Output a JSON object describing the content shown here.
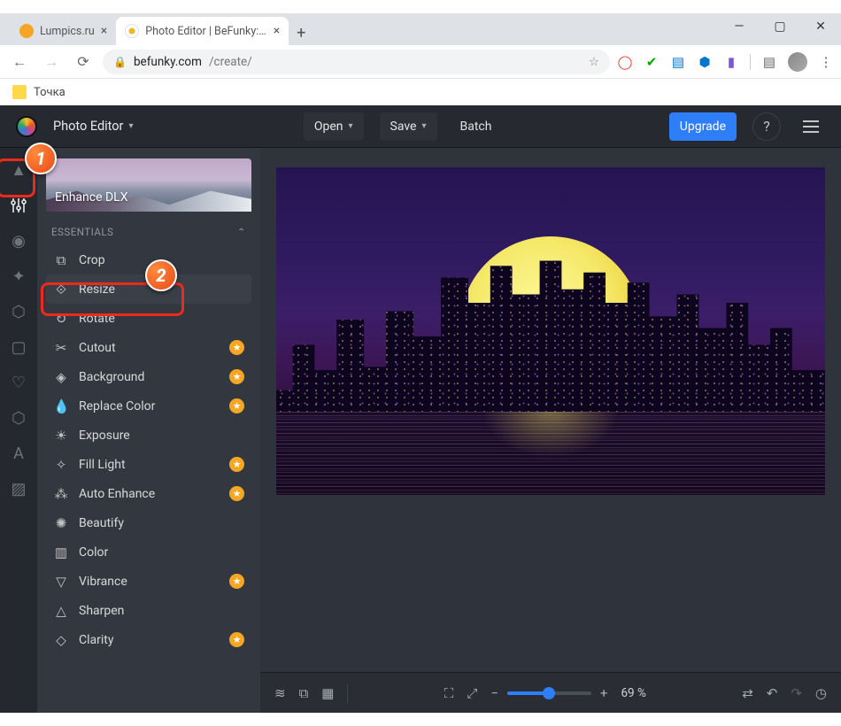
{
  "browser": {
    "tabs": [
      {
        "title": "Lumpics.ru",
        "favcolor": "#f5a623"
      },
      {
        "title": "Photo Editor | BeFunky: Free Onli",
        "favcolor": "#fff"
      }
    ],
    "url_domain": "befunky.com",
    "url_path": "/create/",
    "bookmark": "Точка",
    "ext_icons": [
      "star",
      "red",
      "green",
      "blue",
      "cube",
      "purple",
      "sep",
      "chat"
    ]
  },
  "app": {
    "mode": "Photo Editor",
    "open": "Open",
    "save": "Save",
    "batch": "Batch",
    "upgrade": "Upgrade"
  },
  "panel": {
    "hero": "Enhance DLX",
    "section": "ESSENTIALS",
    "items": [
      {
        "icon": "crop",
        "label": "Crop",
        "premium": false
      },
      {
        "icon": "resize",
        "label": "Resize",
        "premium": false,
        "highlight": true
      },
      {
        "icon": "rotate",
        "label": "Rotate",
        "premium": false
      },
      {
        "icon": "cutout",
        "label": "Cutout",
        "premium": true
      },
      {
        "icon": "bg",
        "label": "Background",
        "premium": true
      },
      {
        "icon": "replace",
        "label": "Replace Color",
        "premium": true
      },
      {
        "icon": "exposure",
        "label": "Exposure",
        "premium": false
      },
      {
        "icon": "fill",
        "label": "Fill Light",
        "premium": true
      },
      {
        "icon": "auto",
        "label": "Auto Enhance",
        "premium": true
      },
      {
        "icon": "beautify",
        "label": "Beautify",
        "premium": false
      },
      {
        "icon": "color",
        "label": "Color",
        "premium": false
      },
      {
        "icon": "vibrance",
        "label": "Vibrance",
        "premium": true
      },
      {
        "icon": "sharpen",
        "label": "Sharpen",
        "premium": false
      },
      {
        "icon": "clarity",
        "label": "Clarity",
        "premium": true
      }
    ]
  },
  "toolbar": {
    "zoom": "69 %"
  },
  "annotations": {
    "badge1": "1",
    "badge2": "2"
  }
}
